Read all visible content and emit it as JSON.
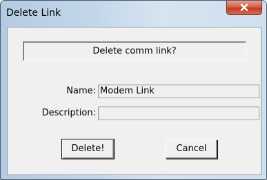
{
  "window": {
    "title": "Delete Link",
    "close_icon": "close-x-icon"
  },
  "dialog": {
    "message": "Delete comm link?",
    "fields": {
      "name_label": "Name:",
      "name_value": "Modem Link",
      "description_label": "Description:",
      "description_value": ""
    },
    "buttons": {
      "delete_label": "Delete!",
      "cancel_label": "Cancel"
    }
  },
  "colors": {
    "title_bar": "#c3d6ea",
    "close_button": "#c23b22",
    "dialog_face": "#f0f0f0"
  }
}
